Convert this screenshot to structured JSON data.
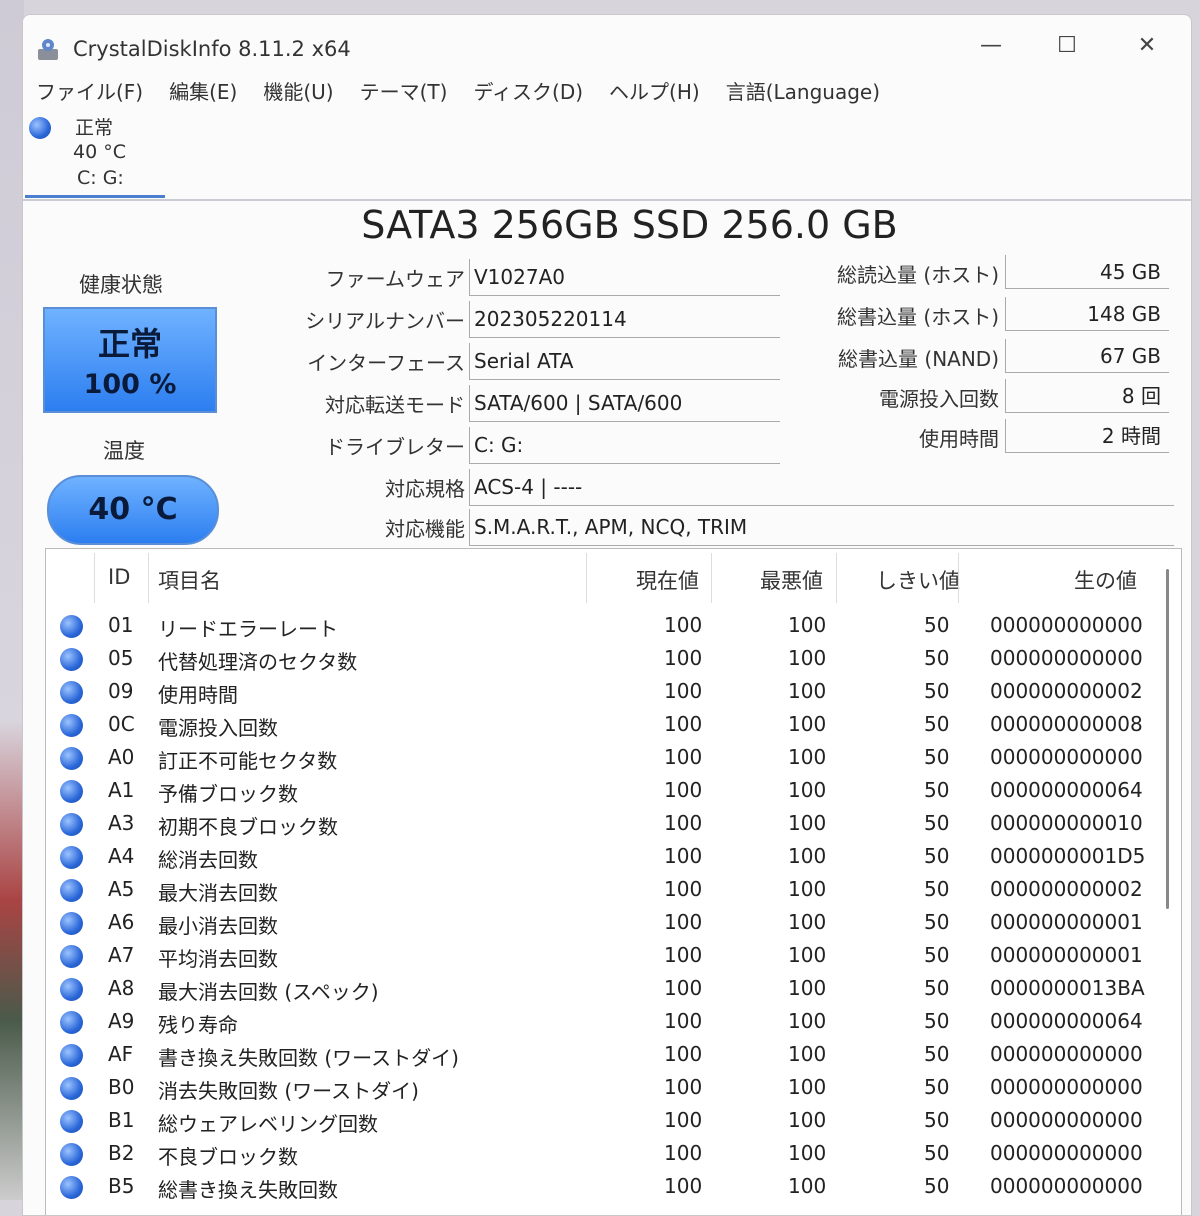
{
  "window": {
    "title": "CrystalDiskInfo 8.11.2 x64",
    "minimize": "—",
    "maximize": "☐",
    "close": "✕"
  },
  "menu": [
    "ファイル(F)",
    "編集(E)",
    "機能(U)",
    "テーマ(T)",
    "ディスク(D)",
    "ヘルプ(H)",
    "言語(Language)"
  ],
  "disk_tab": {
    "status": "正常",
    "temp": "40 °C",
    "drives": "C: G:"
  },
  "model": "SATA3 256GB SSD 256.0 GB",
  "health": {
    "label": "健康状態",
    "status": "正常",
    "percent": "100 %"
  },
  "temperature": {
    "label": "温度",
    "value": "40 °C"
  },
  "info": [
    {
      "label": "ファームウェア",
      "value": "V1027A0"
    },
    {
      "label": "シリアルナンバー",
      "value": "202305220114"
    },
    {
      "label": "インターフェース",
      "value": "Serial ATA"
    },
    {
      "label": "対応転送モード",
      "value": "SATA/600 | SATA/600"
    },
    {
      "label": "ドライブレター",
      "value": "C: G:"
    },
    {
      "label": "対応規格",
      "value": "ACS-4 | ----"
    },
    {
      "label": "対応機能",
      "value": "S.M.A.R.T., APM, NCQ, TRIM"
    }
  ],
  "stats": [
    {
      "label": "総読込量 (ホスト)",
      "value": "45 GB"
    },
    {
      "label": "総書込量 (ホスト)",
      "value": "148 GB"
    },
    {
      "label": "総書込量 (NAND)",
      "value": "67 GB"
    },
    {
      "label": "電源投入回数",
      "value": "8 回"
    },
    {
      "label": "使用時間",
      "value": "2 時間"
    }
  ],
  "smart_headers": {
    "id": "ID",
    "name": "項目名",
    "current": "現在値",
    "worst": "最悪値",
    "threshold": "しきい値",
    "raw": "生の値"
  },
  "smart": [
    {
      "id": "01",
      "name": "リードエラーレート",
      "current": "100",
      "worst": "100",
      "threshold": "50",
      "raw": "000000000000"
    },
    {
      "id": "05",
      "name": "代替処理済のセクタ数",
      "current": "100",
      "worst": "100",
      "threshold": "50",
      "raw": "000000000000"
    },
    {
      "id": "09",
      "name": "使用時間",
      "current": "100",
      "worst": "100",
      "threshold": "50",
      "raw": "000000000002"
    },
    {
      "id": "0C",
      "name": "電源投入回数",
      "current": "100",
      "worst": "100",
      "threshold": "50",
      "raw": "000000000008"
    },
    {
      "id": "A0",
      "name": "訂正不可能セクタ数",
      "current": "100",
      "worst": "100",
      "threshold": "50",
      "raw": "000000000000"
    },
    {
      "id": "A1",
      "name": "予備ブロック数",
      "current": "100",
      "worst": "100",
      "threshold": "50",
      "raw": "000000000064"
    },
    {
      "id": "A3",
      "name": "初期不良ブロック数",
      "current": "100",
      "worst": "100",
      "threshold": "50",
      "raw": "000000000010"
    },
    {
      "id": "A4",
      "name": "総消去回数",
      "current": "100",
      "worst": "100",
      "threshold": "50",
      "raw": "0000000001D5"
    },
    {
      "id": "A5",
      "name": "最大消去回数",
      "current": "100",
      "worst": "100",
      "threshold": "50",
      "raw": "000000000002"
    },
    {
      "id": "A6",
      "name": "最小消去回数",
      "current": "100",
      "worst": "100",
      "threshold": "50",
      "raw": "000000000001"
    },
    {
      "id": "A7",
      "name": "平均消去回数",
      "current": "100",
      "worst": "100",
      "threshold": "50",
      "raw": "000000000001"
    },
    {
      "id": "A8",
      "name": "最大消去回数 (スペック)",
      "current": "100",
      "worst": "100",
      "threshold": "50",
      "raw": "0000000013BA"
    },
    {
      "id": "A9",
      "name": "残り寿命",
      "current": "100",
      "worst": "100",
      "threshold": "50",
      "raw": "000000000064"
    },
    {
      "id": "AF",
      "name": "書き換え失敗回数 (ワーストダイ)",
      "current": "100",
      "worst": "100",
      "threshold": "50",
      "raw": "000000000000"
    },
    {
      "id": "B0",
      "name": "消去失敗回数 (ワーストダイ)",
      "current": "100",
      "worst": "100",
      "threshold": "50",
      "raw": "000000000000"
    },
    {
      "id": "B1",
      "name": "総ウェアレベリング回数",
      "current": "100",
      "worst": "100",
      "threshold": "50",
      "raw": "000000000000"
    },
    {
      "id": "B2",
      "name": "不良ブロック数",
      "current": "100",
      "worst": "100",
      "threshold": "50",
      "raw": "000000000000"
    },
    {
      "id": "B5",
      "name": "総書き換え失敗回数",
      "current": "100",
      "worst": "100",
      "threshold": "50",
      "raw": "000000000000"
    }
  ]
}
